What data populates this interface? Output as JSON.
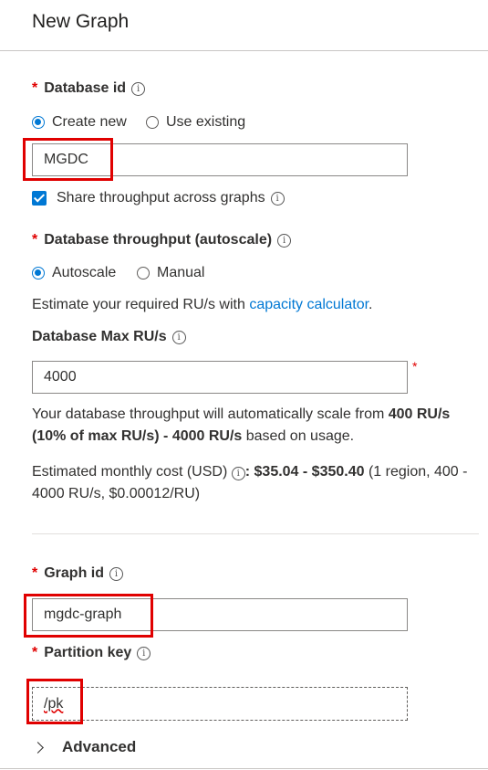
{
  "header": {
    "title": "New Graph"
  },
  "database": {
    "label": "Database id",
    "options": {
      "create_new": "Create new",
      "use_existing": "Use existing"
    },
    "value": "MGDC",
    "share_throughput": "Share throughput across graphs"
  },
  "throughput": {
    "label": "Database throughput (autoscale)",
    "options": {
      "autoscale": "Autoscale",
      "manual": "Manual"
    },
    "estimate_prefix": "Estimate your required RU/s with ",
    "estimate_link": "capacity calculator",
    "estimate_suffix": ".",
    "max_label": "Database Max RU/s",
    "max_value": "4000",
    "scale_text_1": "Your database throughput will automatically scale from ",
    "scale_bold_1": "400 RU/s (10% of max RU/s) - 4000 RU/s",
    "scale_text_2": " based on usage.",
    "cost_prefix": "Estimated monthly cost (USD) ",
    "cost_bold": "$35.04 - $350.40",
    "cost_suffix": " (1 region, 400 - 4000 RU/s, $0.00012/RU)"
  },
  "graph": {
    "label": "Graph id",
    "value": "mgdc-graph",
    "partition_label": "Partition key",
    "partition_value": "/pk"
  },
  "advanced": {
    "label": "Advanced"
  },
  "required_mark": "*",
  "info_glyph": "i",
  "colors": {
    "accent": "#0078d4",
    "required": "#e00000",
    "highlight": "#e00000"
  }
}
